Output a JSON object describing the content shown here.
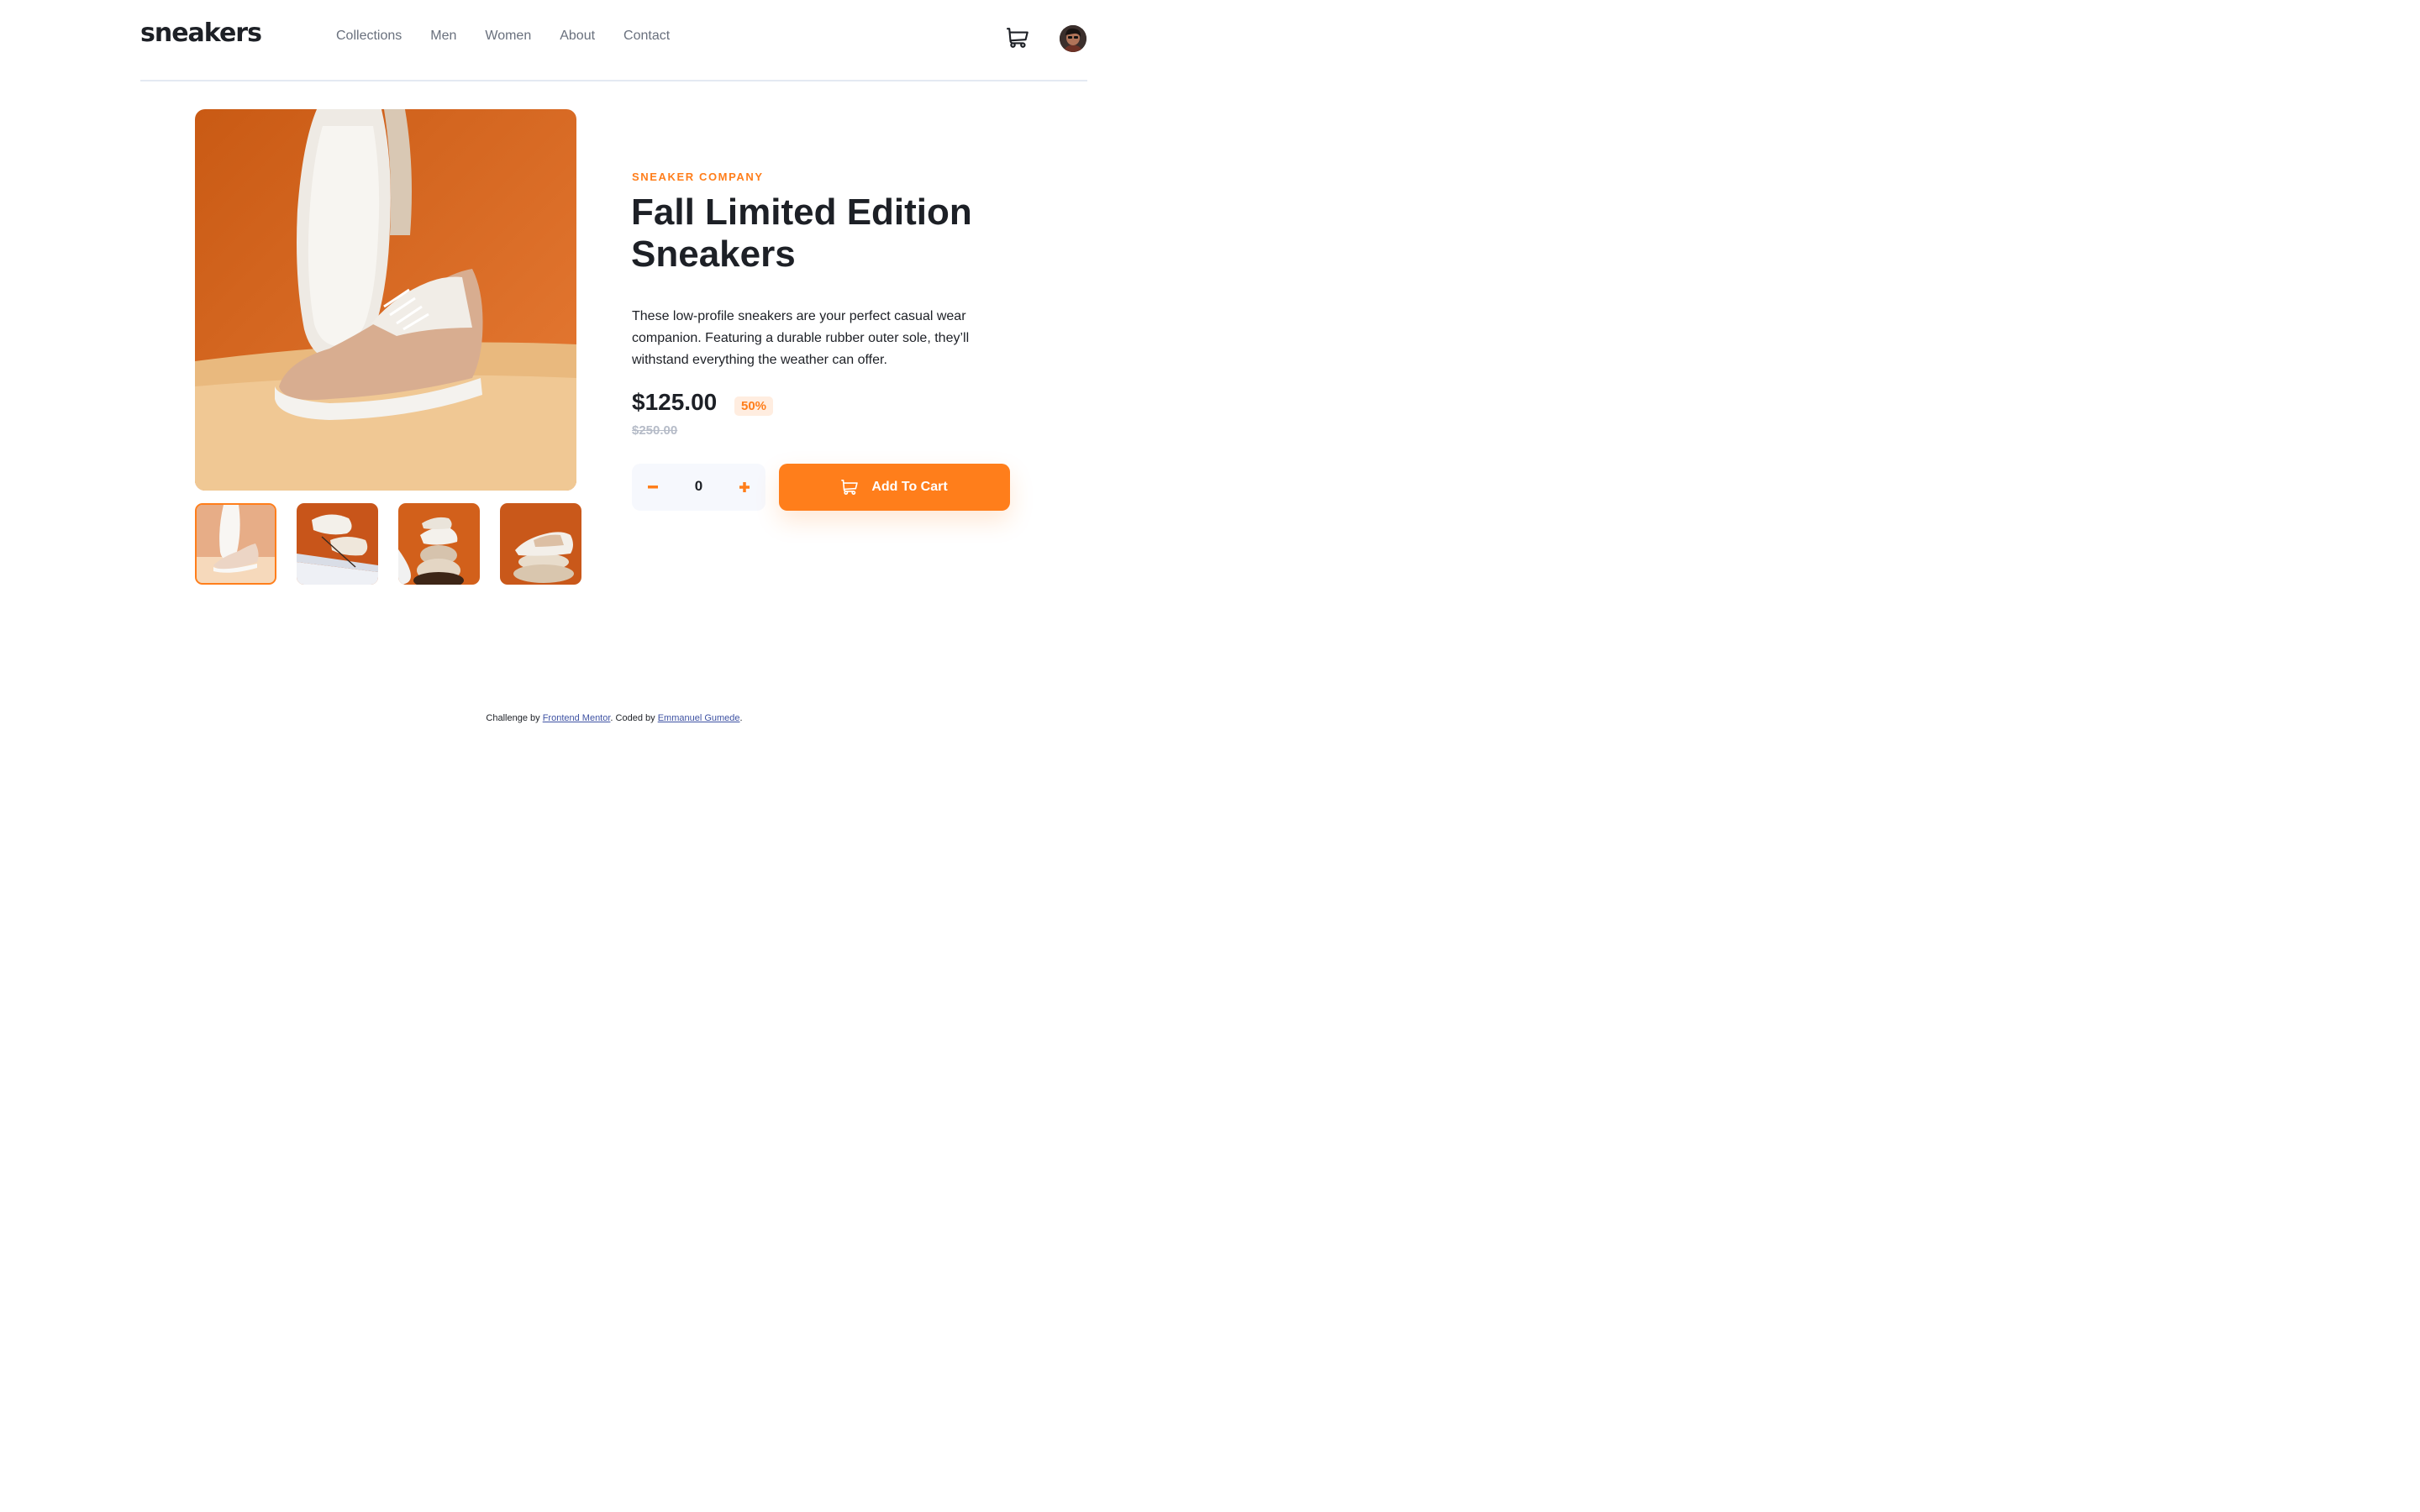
{
  "header": {
    "logo": "sneakers",
    "nav": [
      "Collections",
      "Men",
      "Women",
      "About",
      "Contact"
    ]
  },
  "product": {
    "company": "SNEAKER COMPANY",
    "title": "Fall Limited Edition Sneakers",
    "description": "These low-profile sneakers are your perfect casual wear companion. Featuring a durable rubber outer sole, they’ll withstand everything the weather can offer.",
    "price": "$125.00",
    "discount": "50%",
    "original_price": "$250.00",
    "quantity": "0",
    "add_to_cart": "Add To Cart"
  },
  "gallery": {
    "thumbnail_count": 4,
    "active_index": 0
  },
  "footer": {
    "challenge_prefix": "Challenge by",
    "challenge_link": "Frontend Mentor",
    "coded_prefix": ". Coded by",
    "coded_link": "Emmanuel Gumede",
    "suffix": "."
  },
  "colors": {
    "accent": "#ff7e1b",
    "accent_light": "#ffede0",
    "text_dark": "#1d2026",
    "text_gray": "#69707d"
  },
  "icons": [
    "cart-icon",
    "avatar",
    "minus-icon",
    "plus-icon"
  ]
}
